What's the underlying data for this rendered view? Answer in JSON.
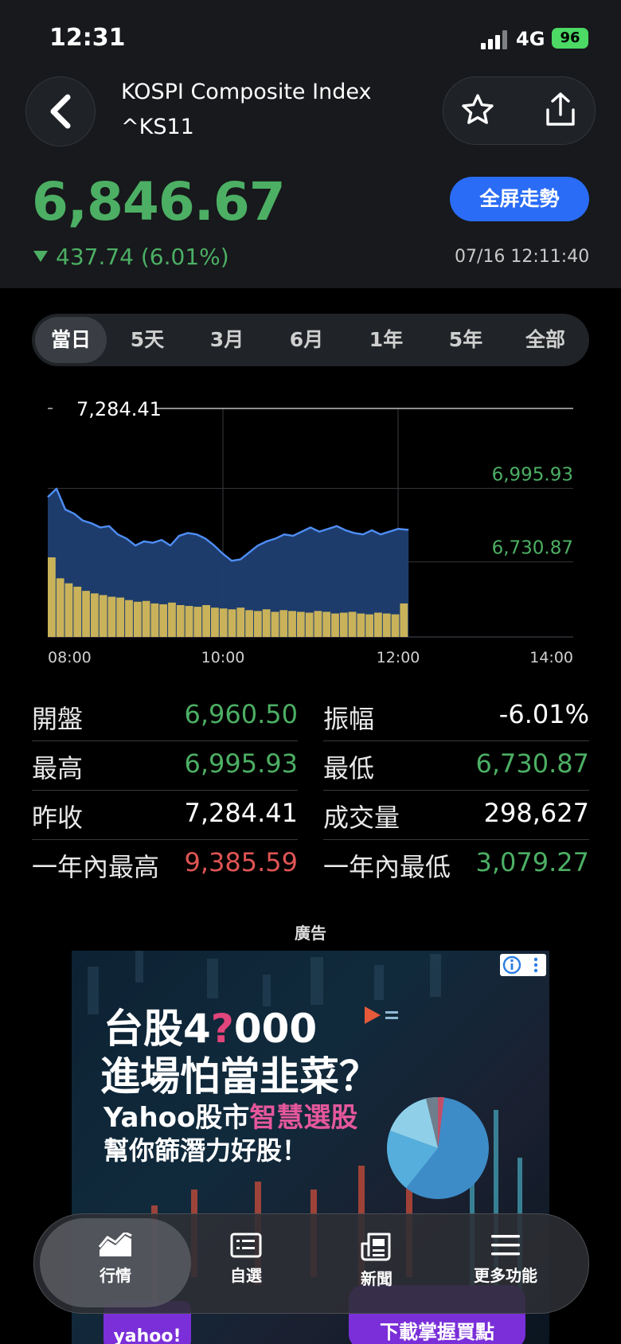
{
  "status_bar": {
    "time": "12:31",
    "network": "4G",
    "battery": "96"
  },
  "header": {
    "title": "KOSPI Composite Index",
    "symbol": "^KS11"
  },
  "quote": {
    "price": "6,846.67",
    "change": "437.74 (6.01%)",
    "direction": "down",
    "updated": "07/16 12:11:40",
    "fullscreen_label": "全屏走勢"
  },
  "range_tabs": [
    {
      "label": "當日",
      "active": true
    },
    {
      "label": "5天",
      "active": false
    },
    {
      "label": "3月",
      "active": false
    },
    {
      "label": "6月",
      "active": false
    },
    {
      "label": "1年",
      "active": false
    },
    {
      "label": "5年",
      "active": false
    },
    {
      "label": "全部",
      "active": false
    }
  ],
  "chart_data": {
    "type": "area",
    "reference_labels": {
      "prev_close": "7,284.41",
      "high": "6,995.93",
      "low": "6,730.87"
    },
    "reference_values": {
      "prev_close": 7284.41,
      "high": 6995.93,
      "low": 6730.87
    },
    "ylim": [
      6460,
      7284.41
    ],
    "x_ticks": [
      "08:00",
      "10:00",
      "12:00",
      "14:00"
    ],
    "x_range_hours": [
      8,
      14
    ],
    "series": [
      {
        "x": [
          8.0,
          8.1,
          8.2,
          8.3,
          8.4,
          8.5,
          8.6,
          8.7,
          8.8,
          8.9,
          9.0,
          9.1,
          9.2,
          9.3,
          9.4,
          9.5,
          9.6,
          9.7,
          9.8,
          9.9,
          10.0,
          10.1,
          10.2,
          10.3,
          10.4,
          10.5,
          10.6,
          10.7,
          10.8,
          10.9,
          11.0,
          11.1,
          11.2,
          11.3,
          11.4,
          11.5,
          11.6,
          11.7,
          11.8,
          11.9,
          12.0,
          12.12
        ],
        "values": [
          6965,
          6995,
          6920,
          6905,
          6880,
          6870,
          6855,
          6860,
          6830,
          6815,
          6790,
          6805,
          6800,
          6810,
          6790,
          6825,
          6835,
          6830,
          6815,
          6790,
          6760,
          6735,
          6740,
          6765,
          6790,
          6805,
          6815,
          6830,
          6825,
          6840,
          6855,
          6840,
          6850,
          6860,
          6845,
          6835,
          6830,
          6845,
          6830,
          6840,
          6850,
          6846.67
        ]
      }
    ],
    "volume": [
      95,
      70,
      64,
      60,
      55,
      52,
      50,
      48,
      47,
      44,
      42,
      43,
      40,
      39,
      41,
      38,
      37,
      36,
      38,
      35,
      34,
      33,
      35,
      32,
      31,
      33,
      30,
      32,
      31,
      30,
      29,
      31,
      30,
      28,
      29,
      30,
      28,
      27,
      29,
      28,
      27,
      40
    ]
  },
  "stats": {
    "left": [
      {
        "label": "開盤",
        "value": "6,960.50",
        "color": "green"
      },
      {
        "label": "最高",
        "value": "6,995.93",
        "color": "green"
      },
      {
        "label": "昨收",
        "value": "7,284.41",
        "color": "white"
      },
      {
        "label": "一年內最高",
        "value": "9,385.59",
        "color": "red"
      }
    ],
    "right": [
      {
        "label": "振幅",
        "value": "-6.01%",
        "color": "white"
      },
      {
        "label": "最低",
        "value": "6,730.87",
        "color": "green"
      },
      {
        "label": "成交量",
        "value": "298,627",
        "color": "white"
      },
      {
        "label": "一年內最低",
        "value": "3,079.27",
        "color": "green"
      }
    ]
  },
  "ad": {
    "label": "廣告",
    "line1_a": "台股4",
    "line1_q": "?",
    "line1_b": "000",
    "line2": "進場怕當韭菜？",
    "line3_a": "Yahoo股市",
    "line3_b": "智慧選股",
    "line4": "幫你篩潛力好股！",
    "bottom_left": "yahoo!",
    "bottom_right": "下載掌握買點"
  },
  "bottom_nav": [
    {
      "label": "行情",
      "icon": "market-chart-icon",
      "active": true
    },
    {
      "label": "自選",
      "icon": "watchlist-icon",
      "active": false
    },
    {
      "label": "新聞",
      "icon": "news-icon",
      "active": false
    },
    {
      "label": "更多功能",
      "icon": "menu-icon",
      "active": false
    }
  ],
  "colors": {
    "up_green": "#4caf64",
    "down_red": "#e05454",
    "accent_blue": "#2a6cf5",
    "line_blue": "#4f8ef5",
    "volume_yellow": "#c9b25a"
  }
}
